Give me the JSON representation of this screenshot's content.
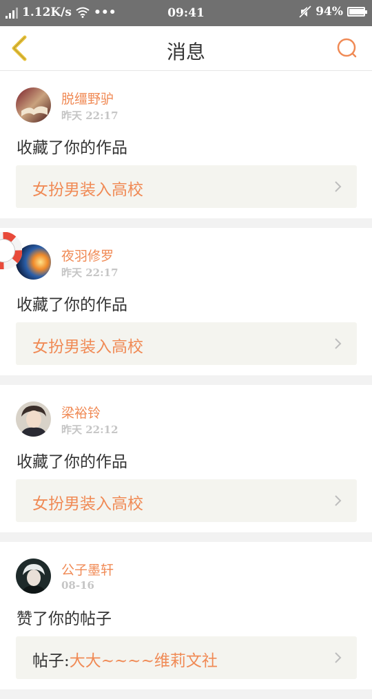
{
  "status": {
    "speed": "1.12K/s",
    "dots": "•••",
    "time": "09:41",
    "battery": "94%",
    "battery_level": 0.94
  },
  "nav": {
    "title": "消息",
    "back_icon": "chevron-left-icon",
    "search_icon": "search-icon"
  },
  "colors": {
    "accent": "#f08a55",
    "back_icon": "#e8c23a",
    "background": "#f2f2f2"
  },
  "messages": [
    {
      "name": "脱缰野驴",
      "time_label": "昨天",
      "time": "22:17",
      "action": "收藏了你的作品",
      "work_prefix": "",
      "work_title": "女扮男装入高校"
    },
    {
      "name": "夜羽修罗",
      "time_label": "昨天",
      "time": "22:17",
      "action": "收藏了你的作品",
      "work_prefix": "",
      "work_title": "女扮男装入高校"
    },
    {
      "name": "梁裕铃",
      "time_label": "昨天",
      "time": "22:12",
      "action": "收藏了你的作品",
      "work_prefix": "",
      "work_title": "女扮男装入高校"
    },
    {
      "name": "公子墨轩",
      "time_label": "",
      "time": "08-16",
      "action": "赞了你的帖子",
      "work_prefix": "帖子:",
      "work_title": "大大~~~~维莉文社"
    }
  ]
}
